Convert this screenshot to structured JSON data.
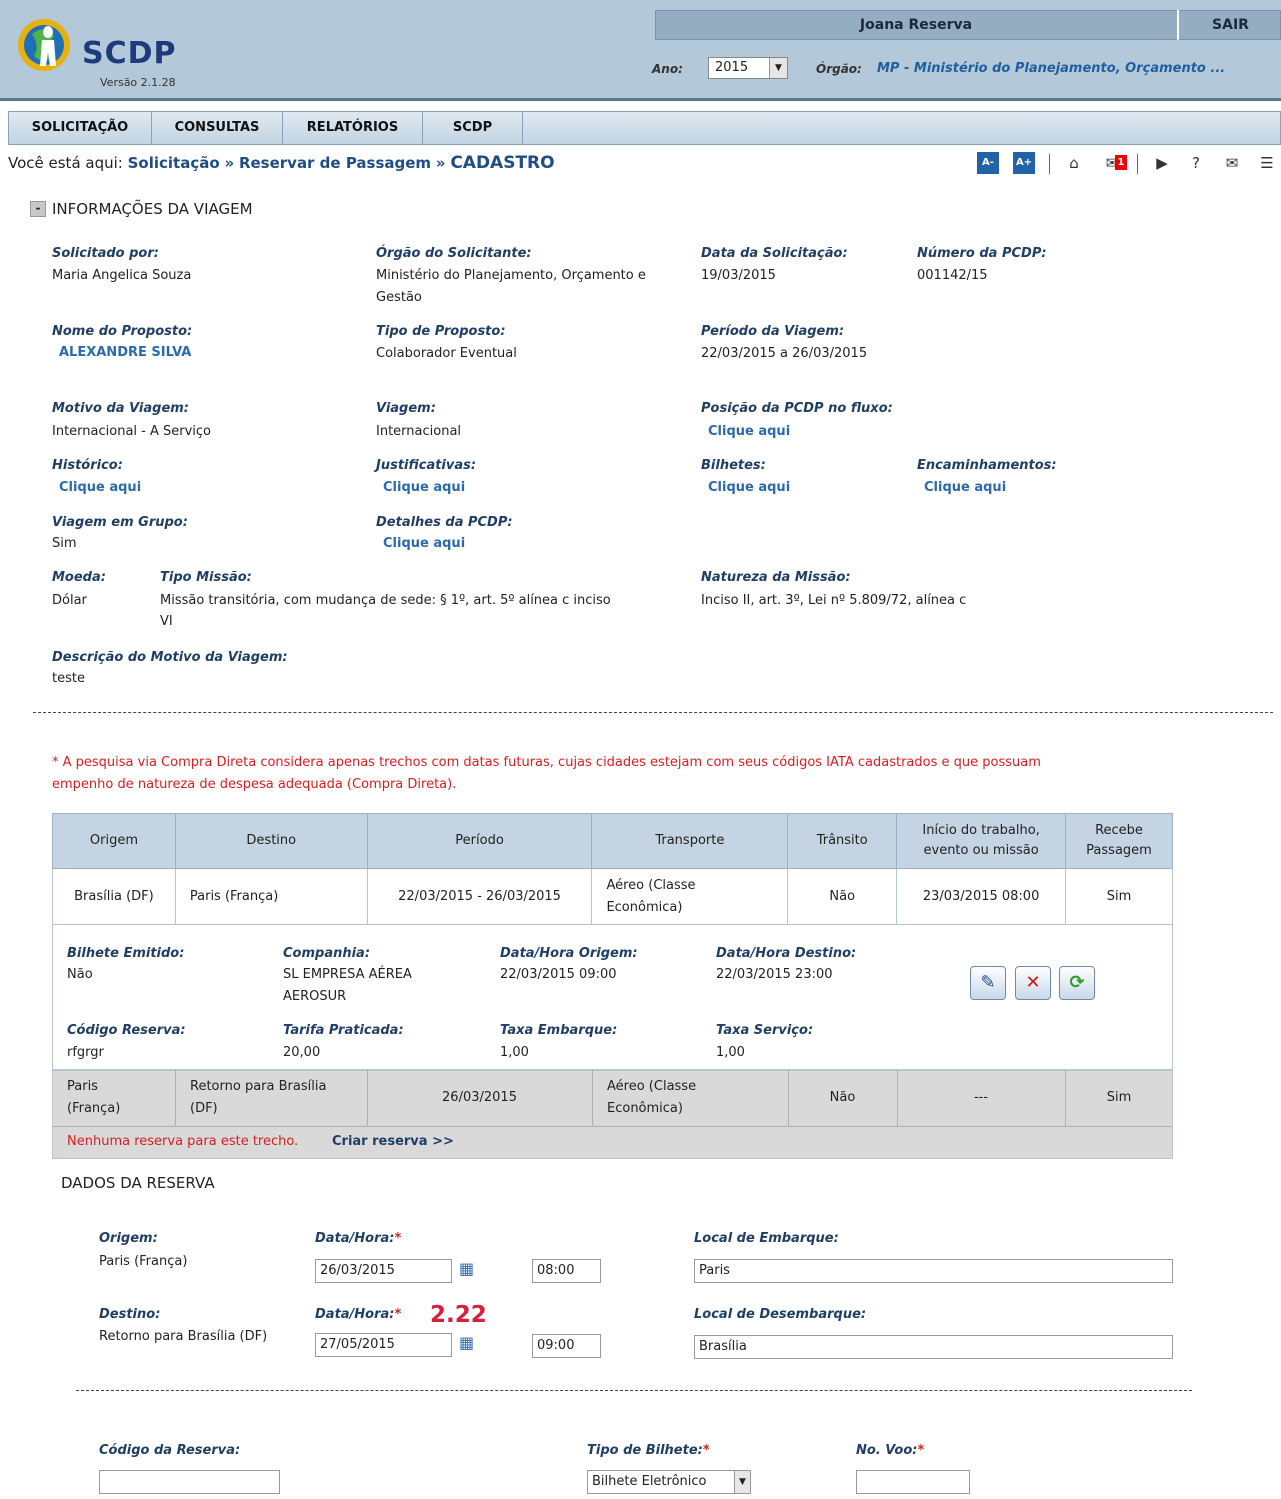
{
  "header": {
    "app_name": "SCDP",
    "version": "Versão 2.1.28",
    "user_name": "Joana Reserva",
    "logout": "SAIR",
    "ano_label": "Ano:",
    "ano_value": "2015",
    "orgao_label": "Órgão:",
    "orgao_value": "MP - Ministério do Planejamento, Orçamento ..."
  },
  "menu": [
    "SOLICITAÇÃO",
    "CONSULTAS",
    "RELATÓRIOS",
    "SCDP"
  ],
  "breadcrumb": {
    "prefix": "Você está aqui:",
    "items": [
      "Solicitação",
      "Reservar de Passagem",
      "CADASTRO"
    ],
    "separator": "»"
  },
  "toolbar": {
    "font_decrease": "A-",
    "font_increase": "A+",
    "notification_count": "1",
    "icons": [
      "home-icon",
      "notification-icon",
      "video-icon",
      "help-icon",
      "mail-icon",
      "chat-icon"
    ]
  },
  "section": {
    "toggle": "-",
    "title": "INFORMAÇÕES DA VIAGEM"
  },
  "info": {
    "solicitado_por_label": "Solicitado por:",
    "solicitado_por": "Maria Angelica Souza",
    "orgao_solicitante_label": "Órgão do Solicitante:",
    "orgao_solicitante_1": "Ministério do Planejamento, Orçamento e",
    "orgao_solicitante_2": "Gestão",
    "data_solicitacao_label": "Data da Solicitação:",
    "data_solicitacao": "19/03/2015",
    "numero_pcdp_label": "Número da PCDP:",
    "numero_pcdp": "001142/15",
    "nome_proposto_label": "Nome do Proposto:",
    "nome_proposto": "ALEXANDRE SILVA",
    "tipo_proposto_label": "Tipo de Proposto:",
    "tipo_proposto": "Colaborador Eventual",
    "periodo_label": "Período da Viagem:",
    "periodo": "22/03/2015 a 26/03/2015",
    "motivo_label": "Motivo da Viagem:",
    "motivo": "Internacional - A Serviço",
    "viagem_label": "Viagem:",
    "viagem": "Internacional",
    "posicao_label": "Posição da PCDP no fluxo:",
    "historico_label": "Histórico:",
    "justificativas_label": "Justificativas:",
    "bilhetes_label": "Bilhetes:",
    "encaminhamentos_label": "Encaminhamentos:",
    "grupo_label": "Viagem em Grupo:",
    "grupo": "Sim",
    "detalhes_label": "Detalhes da PCDP:",
    "moeda_label": "Moeda:",
    "moeda": "Dólar",
    "tipo_missao_label": "Tipo Missão:",
    "tipo_missao_1": "Missão transitória, com mudança de sede: § 1º, art. 5º alínea c inciso",
    "tipo_missao_2": "VI",
    "natureza_label": "Natureza da Missão:",
    "natureza": "Inciso II, art. 3º, Lei nº 5.809/72, alínea c",
    "descricao_label": "Descrição do Motivo da Viagem:",
    "descricao": "teste",
    "link_text": "Clique aqui"
  },
  "notice_line1": "* A pesquisa via Compra Direta considera apenas trechos com datas futuras, cujas cidades estejam com seus códigos IATA cadastrados e que possuam",
  "notice_line2": "empenho de natureza de despesa adequada (Compra Direta).",
  "table": {
    "headers": [
      "Origem",
      "Destino",
      "Período",
      "Transporte",
      "Trânsito",
      "Início do trabalho,",
      "evento ou missão",
      "Recebe",
      "Passagem"
    ],
    "row1": [
      "Brasília (DF)",
      "Paris (França)",
      "22/03/2015 - 26/03/2015",
      "Aéreo (Classe",
      "Econômica)",
      "Não",
      "23/03/2015  08:00",
      "Sim"
    ],
    "detail": {
      "bilhete_label": "Bilhete Emitido:",
      "bilhete": "Não",
      "companhia_label": "Companhia:",
      "companhia_1": "SL EMPRESA AÉREA",
      "companhia_2": "AEROSUR",
      "dh_origem_label": "Data/Hora Origem:",
      "dh_origem": "22/03/2015  09:00",
      "dh_destino_label": "Data/Hora Destino:",
      "dh_destino": "22/03/2015  23:00",
      "codigo_label": "Código Reserva:",
      "codigo": "rfgrgr",
      "tarifa_label": "Tarifa Praticada:",
      "tarifa": "20,00",
      "taxa_emb_label": "Taxa Embarque:",
      "taxa_emb": "1,00",
      "taxa_serv_label": "Taxa Serviço:",
      "taxa_serv": "1,00"
    },
    "row2": [
      "Paris",
      "(França)",
      "Retorno para Brasília",
      "(DF)",
      "26/03/2015",
      "Aéreo (Classe",
      "Econômica)",
      "Não",
      "---",
      "Sim"
    ],
    "no_reservation": "Nenhuma reserva para este trecho.",
    "create_reservation": "Criar reserva >>"
  },
  "reserva": {
    "title": "DADOS DA RESERVA",
    "origem_label": "Origem:",
    "origem": "Paris (França)",
    "data_hora_label": "Data/Hora:",
    "required_mark": "*",
    "origem_date": "26/03/2015",
    "origem_time": "08:00",
    "local_embarque_label": "Local de Embarque:",
    "local_embarque": "Paris",
    "destino_label": "Destino:",
    "destino": "Retorno para Brasília (DF)",
    "destino_date": "27/05/2015",
    "destino_time": "09:00",
    "annotation": "2.22",
    "local_desembarque_label": "Local de Desembarque:",
    "local_desembarque": "Brasília",
    "codigo_reserva_label": "Código da Reserva:",
    "codigo_reserva": "",
    "tipo_bilhete_label": "Tipo de Bilhete:",
    "tipo_bilhete": "Bilhete Eletrônico",
    "no_voo_label": "No. Voo:",
    "no_voo": ""
  },
  "colors": {
    "header_bg": "#b3c9d9",
    "link": "#2a6aad",
    "label": "#1f3f66",
    "alert": "#d81e1e"
  }
}
